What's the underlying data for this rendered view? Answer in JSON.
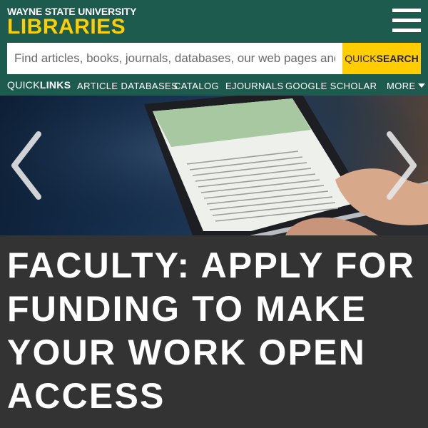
{
  "header": {
    "brand_top": "WAYNE STATE UNIVERSITY",
    "brand_main": "LIBRARIES",
    "menu_icon": "hamburger-menu-icon"
  },
  "search": {
    "placeholder": "Find articles, books, journals, databases, our web pages and more",
    "button_light": "QUICK",
    "button_bold": "SEARCH"
  },
  "quicklinks": {
    "label_light": "QUICK",
    "label_bold": "LINKS",
    "links": [
      "ARTICLE DATABASES",
      "CATALOG",
      "EJOURNALS",
      "GOOGLE SCHOLAR"
    ],
    "more_label": "MORE"
  },
  "carousel": {
    "prev_icon": "chevron-left-icon",
    "next_icon": "chevron-right-icon",
    "slide_title": "FACULTY: APPLY FOR FUNDING TO MAKE YOUR WORK OPEN ACCESS"
  },
  "colors": {
    "header_bg": "#1e5b4f",
    "accent": "#ffcd00",
    "caption_bg": "#333333"
  }
}
